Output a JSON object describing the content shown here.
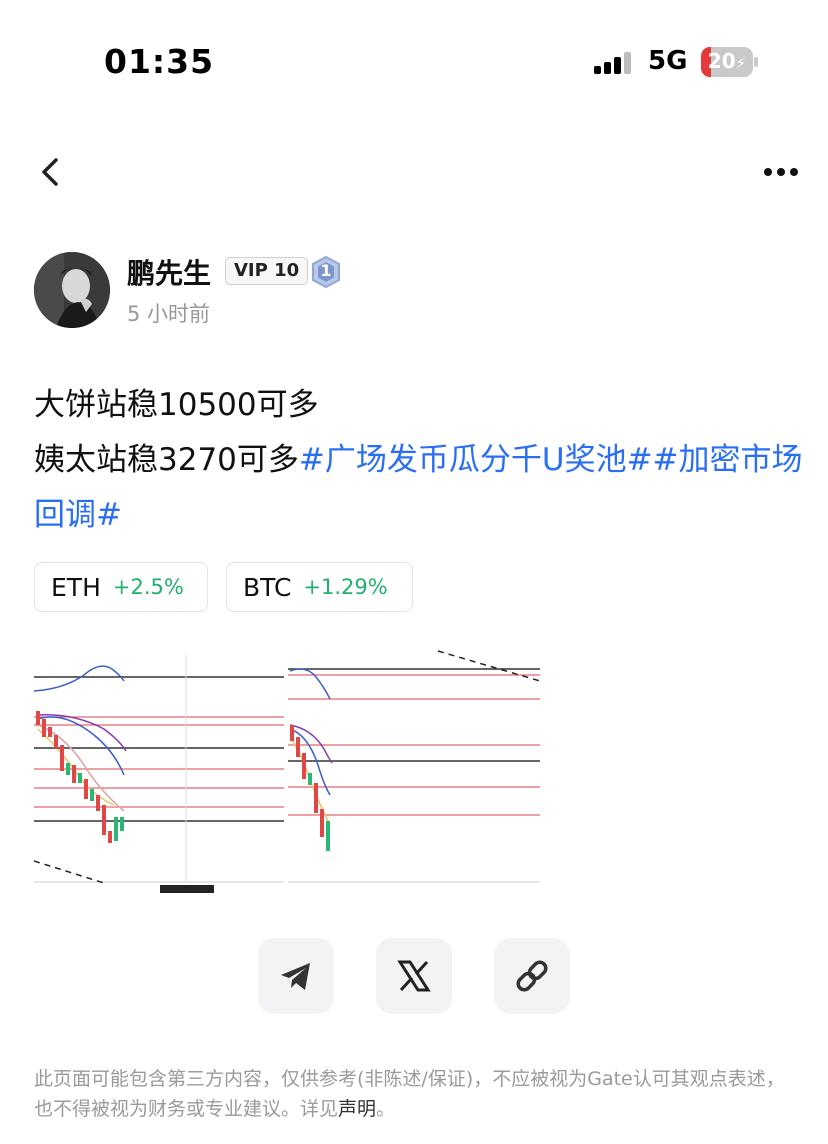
{
  "status_bar": {
    "time": "01:35",
    "network": "5G",
    "battery_level": "20",
    "battery_fraction": 0.2
  },
  "nav": {
    "back_icon": "chevron-left-icon",
    "more_icon": "more-horizontal-icon"
  },
  "author": {
    "name": "鹏先生",
    "vip": "VIP 10",
    "level": "1",
    "time_ago": "5 小时前"
  },
  "post": {
    "line1": "大饼站稳10500可多",
    "line2_text": "姨太站稳3270可多",
    "tag1": "#广场发币瓜分千U奖池#",
    "tag2": "#加密市场回调#"
  },
  "tickers": [
    {
      "symbol": "ETH",
      "change": "+2.5%"
    },
    {
      "symbol": "BTC",
      "change": "+1.29%"
    }
  ],
  "share_buttons": [
    {
      "icon": "telegram-icon"
    },
    {
      "icon": "x-logo-icon"
    },
    {
      "icon": "link-icon"
    }
  ],
  "disclaimer": {
    "text": "此页面可能包含第三方内容，仅供参考(非陈述/保证)，不应被视为Gate认可其观点表述，也不得被视为财务或专业建议。详见",
    "link": "声明",
    "end": "。"
  },
  "colors": {
    "accent_blue": "#2a6ff3",
    "positive_green": "#20b26c",
    "battery_red": "#e5393a",
    "muted_gray": "#999999"
  }
}
